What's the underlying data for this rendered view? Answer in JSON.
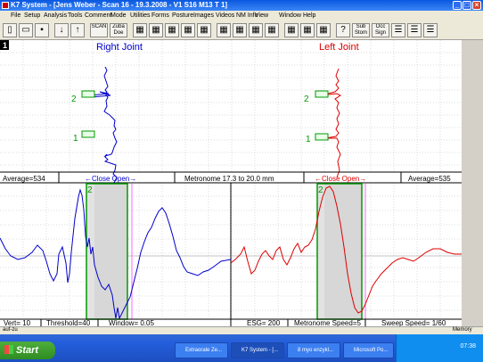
{
  "window": {
    "title": "K7 System - [Jens Weber - Scan 16 - 19.3.2008 - V1 S16   M13 T 1]",
    "status_text": "auf-zu",
    "status_right": "Memory"
  },
  "menu": [
    "File",
    "Setup",
    "Analysis",
    "Tools",
    "Comment",
    "Mode",
    "Utilities",
    "Forms",
    "Posture",
    "Images",
    "Videos",
    "NM Info",
    "View",
    "Window",
    "Help"
  ],
  "toolbar": [
    {
      "icon": "new-file-icon",
      "label": ""
    },
    {
      "icon": "open-folder-icon",
      "label": ""
    },
    {
      "icon": "save-icon",
      "label": ""
    },
    {
      "icon": "arrow-down-icon",
      "label": ""
    },
    {
      "icon": "arrow-up-icon",
      "label": ""
    },
    {
      "icon": "scan-icon",
      "label": "SCAN"
    },
    {
      "icon": "zuba-icon",
      "label": "Zuba Doe"
    },
    {
      "icon": "tool-icon",
      "label": ""
    },
    {
      "icon": "tool-icon",
      "label": ""
    },
    {
      "icon": "tool-icon",
      "label": ""
    },
    {
      "icon": "tool-icon",
      "label": ""
    },
    {
      "icon": "tool-icon",
      "label": ""
    },
    {
      "icon": "tool-icon",
      "label": ""
    },
    {
      "icon": "tool-icon",
      "label": ""
    },
    {
      "icon": "tool-icon",
      "label": ""
    },
    {
      "icon": "tool-icon",
      "label": ""
    },
    {
      "icon": "tool-icon",
      "label": ""
    },
    {
      "icon": "tool-icon",
      "label": ""
    },
    {
      "icon": "tool-icon",
      "label": ""
    },
    {
      "icon": "help-icon",
      "label": ""
    },
    {
      "icon": "sub-stom-icon",
      "label": "Sub Stom"
    },
    {
      "icon": "occ-sign-icon",
      "label": "Occ Sign"
    },
    {
      "icon": "layout-icon",
      "label": ""
    },
    {
      "icon": "layout-icon",
      "label": ""
    },
    {
      "icon": "layout-icon",
      "label": ""
    }
  ],
  "panel_number": "1",
  "top": {
    "right_joint_label": "Right Joint",
    "left_joint_label": "Left Joint",
    "marker1": "1",
    "marker2": "2"
  },
  "info_bar": {
    "average_left": "Average=534",
    "close_open_left": "←Close  Open→",
    "metronome": "Metronome 17.3 to 20.0 mm",
    "close_open_right": "←Close  Open→",
    "average_right": "Average=535"
  },
  "bottom_marker": "2",
  "bottom_bar": {
    "vert": "Vert= 10",
    "threshold": "Threshold=40",
    "window": "Window= 0.05",
    "esg": "ESG= 200",
    "metronome_speed": "Metronome Speed=5",
    "sweep_speed": "Sweep Speed= 1/60"
  },
  "taskbar": {
    "start": "Start",
    "tasks": [
      "Extraorale Ze...",
      "K7 System - [...",
      "8 myo enzykl...",
      "Microsoft Po..."
    ],
    "time": "07:38"
  },
  "colors": {
    "right": "#0000cc",
    "left": "#dd0000",
    "window_green": "#009900"
  }
}
